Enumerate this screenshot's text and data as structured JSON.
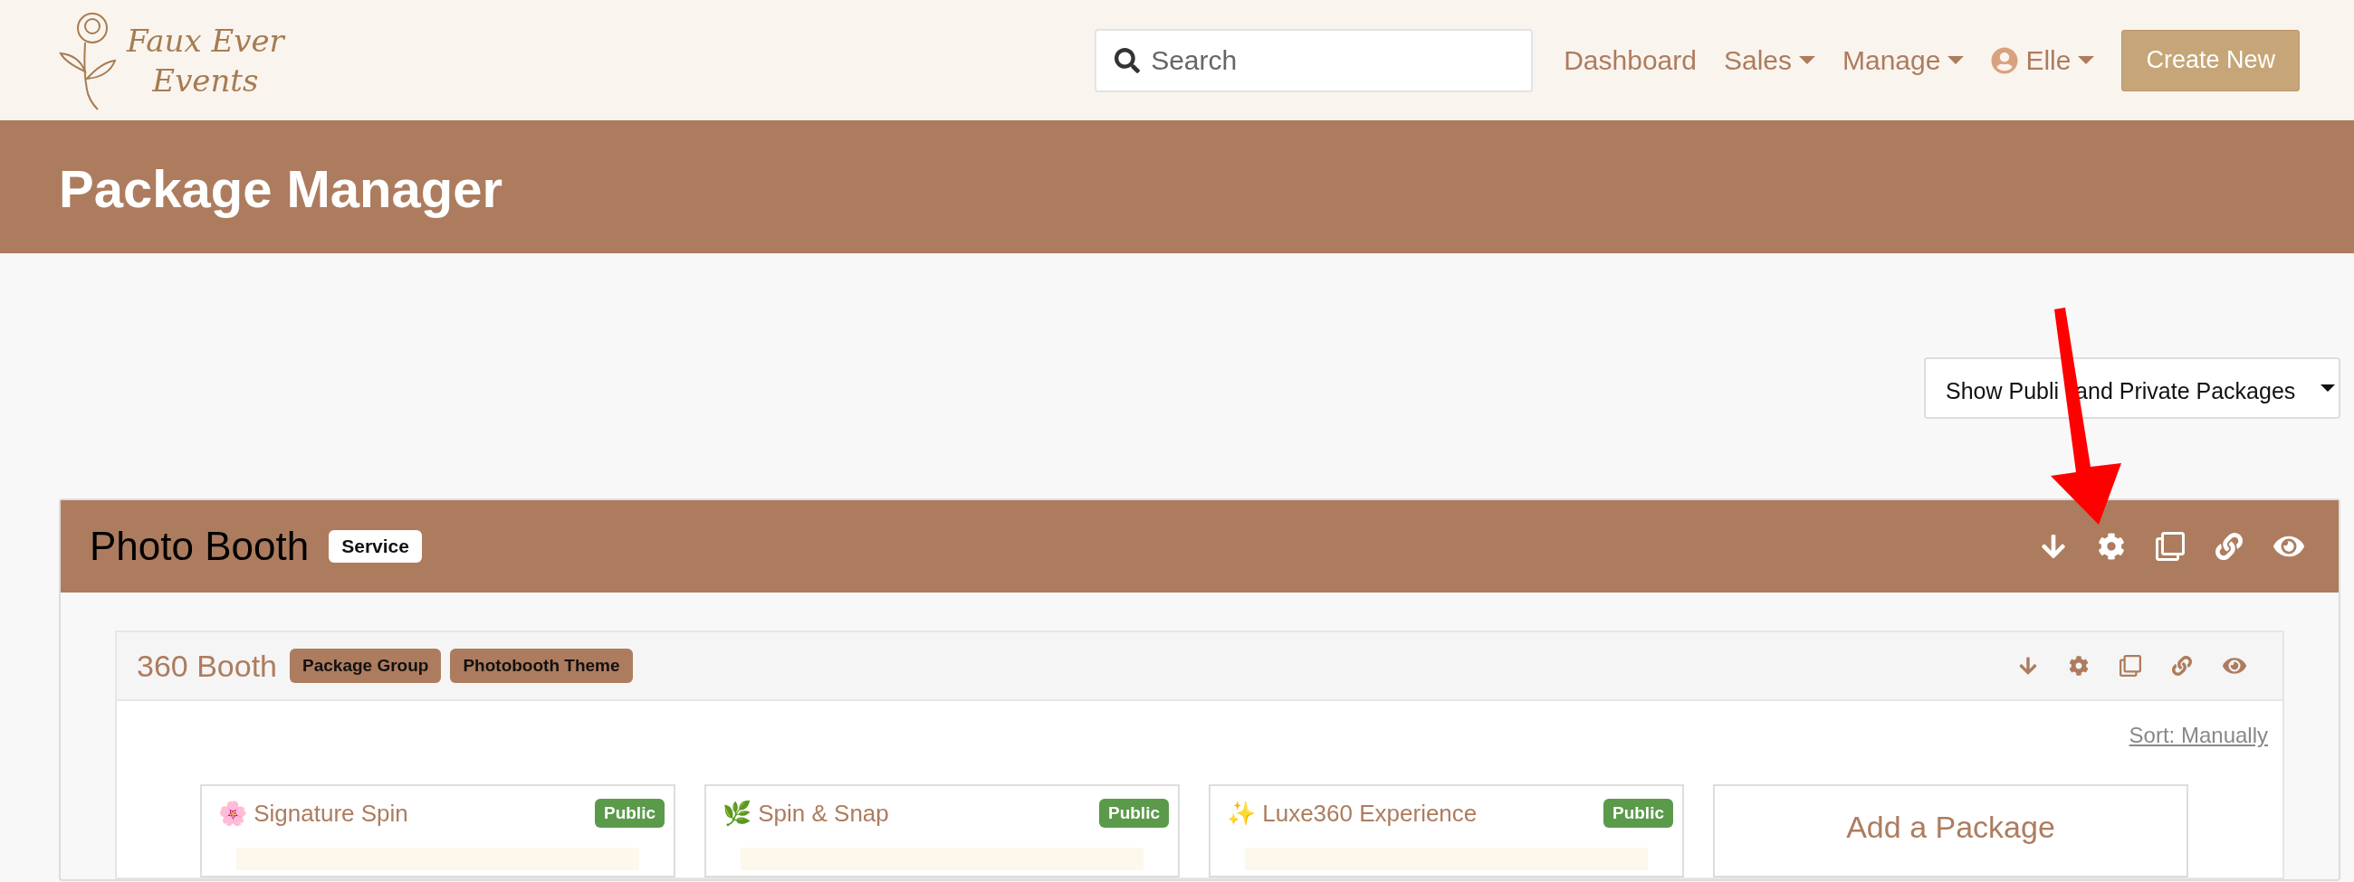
{
  "logo": {
    "lines": [
      "Faux Ever",
      "Events"
    ]
  },
  "search": {
    "placeholder": "Search"
  },
  "nav": [
    {
      "label": "Dashboard",
      "dropdown": false,
      "kind": "link"
    },
    {
      "label": "Sales",
      "dropdown": true,
      "kind": "link"
    },
    {
      "label": "Manage",
      "dropdown": true,
      "kind": "link"
    },
    {
      "label": "Elle",
      "dropdown": true,
      "kind": "user"
    }
  ],
  "create_button": "Create New",
  "page_title": "Package Manager",
  "filter": {
    "value_parts": [
      "Show Publi",
      "and Private Packages"
    ]
  },
  "service": {
    "title": "Photo Booth",
    "badge": "Service",
    "group": {
      "title": "360 Booth",
      "badges": [
        "Package Group",
        "Photobooth Theme"
      ],
      "sort": "Sort: Manually",
      "packages": [
        {
          "title": "🌸 Signature Spin",
          "status": "Public"
        },
        {
          "title": "🌿 Spin & Snap",
          "status": "Public"
        },
        {
          "title": "✨ Luxe360 Experience",
          "status": "Public"
        }
      ],
      "add_label": "Add a Package"
    }
  }
}
